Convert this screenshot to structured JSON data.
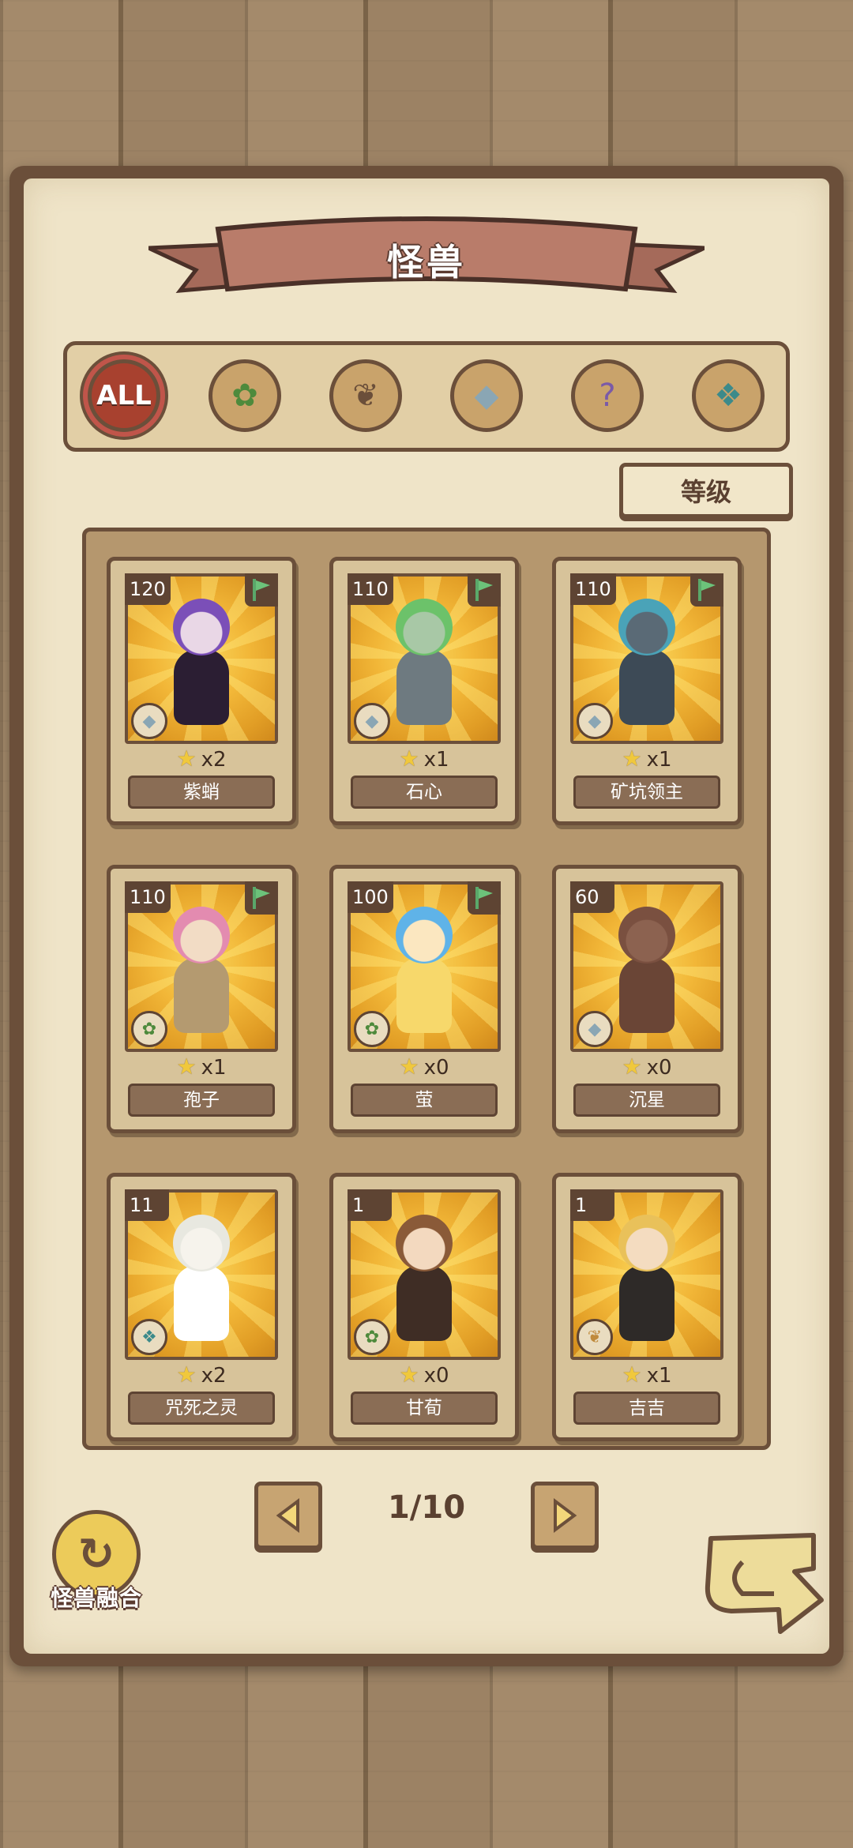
{
  "header": {
    "title": "怪兽"
  },
  "filters": [
    {
      "id": "all",
      "label": "ALL",
      "icon": "all-icon",
      "glyph": "ALL",
      "active": true
    },
    {
      "id": "grass",
      "icon": "leaf-icon",
      "glyph": "✿",
      "active": false
    },
    {
      "id": "beast",
      "icon": "paw-icon",
      "glyph": "❦",
      "active": false
    },
    {
      "id": "crystal",
      "icon": "crystal-icon",
      "glyph": "◆",
      "active": false
    },
    {
      "id": "mystery",
      "icon": "question-icon",
      "glyph": "?",
      "active": false
    },
    {
      "id": "spirit",
      "icon": "spirit-icon",
      "glyph": "❖",
      "active": false
    }
  ],
  "sort": {
    "label": "等级"
  },
  "monsters": [
    {
      "level": "120",
      "count": "x2",
      "name": "紫蛸",
      "element": "crystal-icon",
      "element_glyph": "◆",
      "flag": true,
      "hair": "#7b4fb8",
      "skin": "#e9d7e6",
      "body": "#2b1e33"
    },
    {
      "level": "110",
      "count": "x1",
      "name": "石心",
      "element": "crystal-icon",
      "element_glyph": "◆",
      "flag": true,
      "hair": "#6cc26a",
      "skin": "#a8c8a6",
      "body": "#6e7a80"
    },
    {
      "level": "110",
      "count": "x1",
      "name": "矿坑领主",
      "element": "crystal-icon",
      "element_glyph": "◆",
      "flag": true,
      "hair": "#4aa3b8",
      "skin": "#5a6a76",
      "body": "#3d4a56"
    },
    {
      "level": "110",
      "count": "x1",
      "name": "孢子",
      "element": "leaf-icon",
      "element_glyph": "✿",
      "flag": true,
      "hair": "#e38bb0",
      "skin": "#f2dcc5",
      "body": "#b49a70"
    },
    {
      "level": "100",
      "count": "x0",
      "name": "萤",
      "element": "leaf-icon",
      "element_glyph": "✿",
      "flag": true,
      "hair": "#5fb3e8",
      "skin": "#fbe7c0",
      "body": "#f7d86b"
    },
    {
      "level": "60",
      "count": "x0",
      "name": "沉星",
      "element": "crystal-icon",
      "element_glyph": "◆",
      "flag": false,
      "hair": "#7a5040",
      "skin": "#8c6250",
      "body": "#6a4536"
    },
    {
      "level": "11",
      "count": "x2",
      "name": "咒死之灵",
      "element": "spirit-icon",
      "element_glyph": "❖",
      "flag": false,
      "hair": "#e8e8e0",
      "skin": "#f6f3ec",
      "body": "#ffffff"
    },
    {
      "level": "1",
      "count": "x0",
      "name": "甘荀",
      "element": "leaf-icon",
      "element_glyph": "✿",
      "flag": false,
      "hair": "#8a5a38",
      "skin": "#f3d9bf",
      "body": "#3f2d25"
    },
    {
      "level": "1",
      "count": "x1",
      "name": "吉吉",
      "element": "paw-icon",
      "element_glyph": "❦",
      "flag": false,
      "hair": "#e9c15a",
      "skin": "#f4dcc0",
      "body": "#2e2a28"
    }
  ],
  "pager": {
    "current": "1/10"
  },
  "fuse": {
    "label": "怪兽融合"
  },
  "colors": {
    "accent": "#a8412f",
    "frame": "#6b4f3a",
    "paper": "#efe4c8"
  }
}
